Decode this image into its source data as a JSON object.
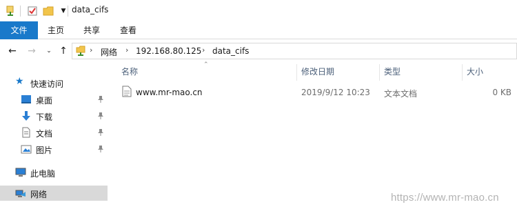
{
  "window": {
    "title": "data_cifs"
  },
  "ribbon": {
    "tabs": [
      "文件",
      "主页",
      "共享",
      "查看"
    ]
  },
  "address": {
    "crumbs": [
      "网络",
      "192.168.80.125",
      "data_cifs"
    ]
  },
  "nav": {
    "quick_access": "快速访问",
    "desktop": "桌面",
    "downloads": "下载",
    "documents": "文档",
    "pictures": "图片",
    "this_pc": "此电脑",
    "network": "网络"
  },
  "columns": {
    "name": "名称",
    "modified": "修改日期",
    "type": "类型",
    "size": "大小"
  },
  "files": [
    {
      "name": "www.mr-mao.cn",
      "modified": "2019/9/12 10:23",
      "type": "文本文档",
      "size": "0 KB"
    }
  ],
  "watermark": "https://www.mr-mao.cn",
  "colors": {
    "accent": "#1979ca",
    "folder": "#f2c54b",
    "selected": "#d9d9d9"
  }
}
